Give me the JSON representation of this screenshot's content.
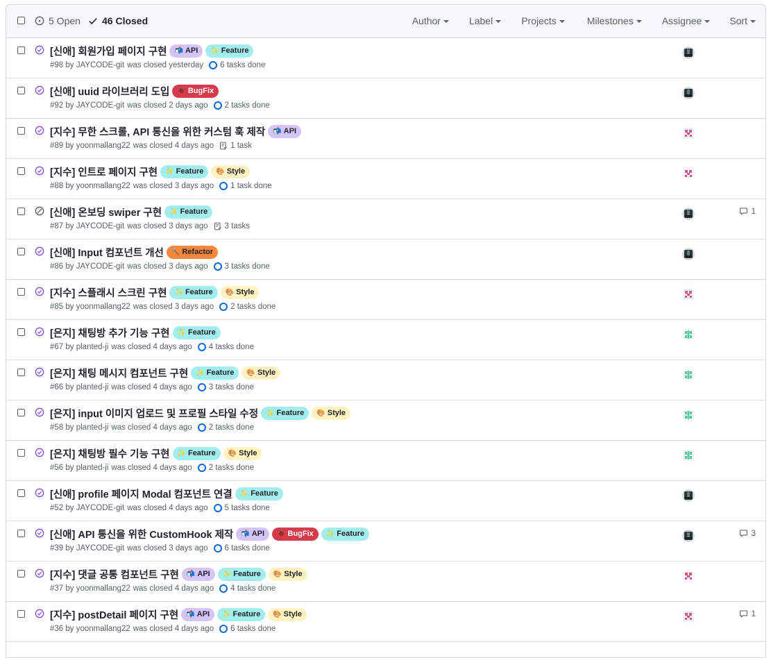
{
  "header": {
    "open_label": "5 Open",
    "closed_label": "46 Closed",
    "filters": [
      "Author",
      "Label",
      "Projects",
      "Milestones",
      "Assignee",
      "Sort"
    ]
  },
  "colors": {
    "purple": "#8250df",
    "blue": "#0969da",
    "gray": "#57606a",
    "api_bg": "#d4c5f9",
    "bugfix_bg": "#d73a4a",
    "feature_bg": "#a2eeef",
    "style_bg": "#fef2c0",
    "refactor_bg": "#f9883c"
  },
  "issues": [
    {
      "title": "[신애] 회원가입 페이지 구현",
      "labels": [
        {
          "emoji": "📬",
          "text": "API",
          "kind": "api"
        },
        {
          "emoji": "✨",
          "text": "Feature",
          "kind": "feature"
        }
      ],
      "number": "#98",
      "author": "JAYCODE-git",
      "closed": "was closed yesterday",
      "tasks": "6 tasks done",
      "task_icon": "ring",
      "state": "completed",
      "avatar": "dark",
      "comments": ""
    },
    {
      "title": "[신애] uuid 라이브러리 도입",
      "labels": [
        {
          "emoji": "🐞",
          "text": "BugFix",
          "kind": "bugfix"
        }
      ],
      "number": "#92",
      "author": "JAYCODE-git",
      "closed": "was closed 2 days ago",
      "tasks": "2 tasks done",
      "task_icon": "ring",
      "state": "completed",
      "avatar": "dark",
      "comments": ""
    },
    {
      "title": "[지수] 무한 스크롤, API 통신을 위한 커스텀 훅 제작",
      "labels": [
        {
          "emoji": "📬",
          "text": "API",
          "kind": "api"
        }
      ],
      "number": "#89",
      "author": "yoonmallang22",
      "closed": "was closed 4 days ago",
      "tasks": "1 task",
      "task_icon": "list",
      "state": "completed",
      "avatar": "pink",
      "comments": ""
    },
    {
      "title": "[지수] 인트로 페이지 구현",
      "labels": [
        {
          "emoji": "✨",
          "text": "Feature",
          "kind": "feature"
        },
        {
          "emoji": "🎨",
          "text": "Style",
          "kind": "style"
        }
      ],
      "number": "#88",
      "author": "yoonmallang22",
      "closed": "was closed 3 days ago",
      "tasks": "1 task done",
      "task_icon": "ring",
      "state": "completed",
      "avatar": "pink",
      "comments": ""
    },
    {
      "title": "[신애] 온보딩 swiper 구현",
      "labels": [
        {
          "emoji": "✨",
          "text": "Feature",
          "kind": "feature"
        }
      ],
      "number": "#87",
      "author": "JAYCODE-git",
      "closed": "was closed 3 days ago",
      "tasks": "3 tasks",
      "task_icon": "list",
      "state": "not-planned",
      "avatar": "dark",
      "comments": "1"
    },
    {
      "title": "[신애] Input 컴포넌트 개선",
      "labels": [
        {
          "emoji": "🔨",
          "text": "Refactor",
          "kind": "refactor"
        }
      ],
      "number": "#86",
      "author": "JAYCODE-git",
      "closed": "was closed 3 days ago",
      "tasks": "3 tasks done",
      "task_icon": "ring",
      "state": "completed",
      "avatar": "dark",
      "comments": ""
    },
    {
      "title": "[지수] 스플래시 스크린 구현",
      "labels": [
        {
          "emoji": "✨",
          "text": "Feature",
          "kind": "feature"
        },
        {
          "emoji": "🎨",
          "text": "Style",
          "kind": "style"
        }
      ],
      "number": "#85",
      "author": "yoonmallang22",
      "closed": "was closed 3 days ago",
      "tasks": "2 tasks done",
      "task_icon": "ring",
      "state": "completed",
      "avatar": "pink",
      "comments": ""
    },
    {
      "title": "[은지] 채팅방 추가 기능 구현",
      "labels": [
        {
          "emoji": "✨",
          "text": "Feature",
          "kind": "feature"
        }
      ],
      "number": "#67",
      "author": "planted-ji",
      "closed": "was closed 4 days ago",
      "tasks": "4 tasks done",
      "task_icon": "ring",
      "state": "completed",
      "avatar": "green",
      "comments": ""
    },
    {
      "title": "[은지] 채팅 메시지 컴포넌트 구현",
      "labels": [
        {
          "emoji": "✨",
          "text": "Feature",
          "kind": "feature"
        },
        {
          "emoji": "🎨",
          "text": "Style",
          "kind": "style"
        }
      ],
      "number": "#66",
      "author": "planted-ji",
      "closed": "was closed 4 days ago",
      "tasks": "3 tasks done",
      "task_icon": "ring",
      "state": "completed",
      "avatar": "green",
      "comments": ""
    },
    {
      "title": "[은지] input 이미지 업로드 및 프로필 스타일 수정",
      "labels": [
        {
          "emoji": "✨",
          "text": "Feature",
          "kind": "feature"
        },
        {
          "emoji": "🎨",
          "text": "Style",
          "kind": "style"
        }
      ],
      "number": "#58",
      "author": "planted-ji",
      "closed": "was closed 4 days ago",
      "tasks": "2 tasks done",
      "task_icon": "ring",
      "state": "completed",
      "avatar": "green",
      "comments": ""
    },
    {
      "title": "[은지] 채팅방 필수 기능 구현",
      "labels": [
        {
          "emoji": "✨",
          "text": "Feature",
          "kind": "feature"
        },
        {
          "emoji": "🎨",
          "text": "Style",
          "kind": "style"
        }
      ],
      "number": "#56",
      "author": "planted-ji",
      "closed": "was closed 4 days ago",
      "tasks": "2 tasks done",
      "task_icon": "ring",
      "state": "completed",
      "avatar": "green",
      "comments": ""
    },
    {
      "title": "[신애] profile 페이지 Modal 컴포넌트 연결",
      "labels": [
        {
          "emoji": "✨",
          "text": "Feature",
          "kind": "feature"
        }
      ],
      "number": "#52",
      "author": "JAYCODE-git",
      "closed": "was closed 4 days ago",
      "tasks": "5 tasks done",
      "task_icon": "ring",
      "state": "completed",
      "avatar": "dark",
      "comments": ""
    },
    {
      "title": "[신애] API 통신을 위한 CustomHook 제작",
      "labels": [
        {
          "emoji": "📬",
          "text": "API",
          "kind": "api"
        },
        {
          "emoji": "🐞",
          "text": "BugFix",
          "kind": "bugfix"
        },
        {
          "emoji": "✨",
          "text": "Feature",
          "kind": "feature"
        }
      ],
      "number": "#39",
      "author": "JAYCODE-git",
      "closed": "was closed 3 days ago",
      "tasks": "6 tasks done",
      "task_icon": "ring",
      "state": "completed",
      "avatar": "dark",
      "comments": "3"
    },
    {
      "title": "[지수] 댓글 공통 컴포넌트 구현",
      "labels": [
        {
          "emoji": "📬",
          "text": "API",
          "kind": "api"
        },
        {
          "emoji": "✨",
          "text": "Feature",
          "kind": "feature"
        },
        {
          "emoji": "🎨",
          "text": "Style",
          "kind": "style"
        }
      ],
      "number": "#37",
      "author": "yoonmallang22",
      "closed": "was closed 4 days ago",
      "tasks": "4 tasks done",
      "task_icon": "ring",
      "state": "completed",
      "avatar": "pink",
      "comments": ""
    },
    {
      "title": "[지수] postDetail 페이지 구현",
      "labels": [
        {
          "emoji": "📬",
          "text": "API",
          "kind": "api"
        },
        {
          "emoji": "✨",
          "text": "Feature",
          "kind": "feature"
        },
        {
          "emoji": "🎨",
          "text": "Style",
          "kind": "style"
        }
      ],
      "number": "#36",
      "author": "yoonmallang22",
      "closed": "was closed 4 days ago",
      "tasks": "6 tasks done",
      "task_icon": "ring",
      "state": "completed",
      "avatar": "pink",
      "comments": "1"
    }
  ]
}
